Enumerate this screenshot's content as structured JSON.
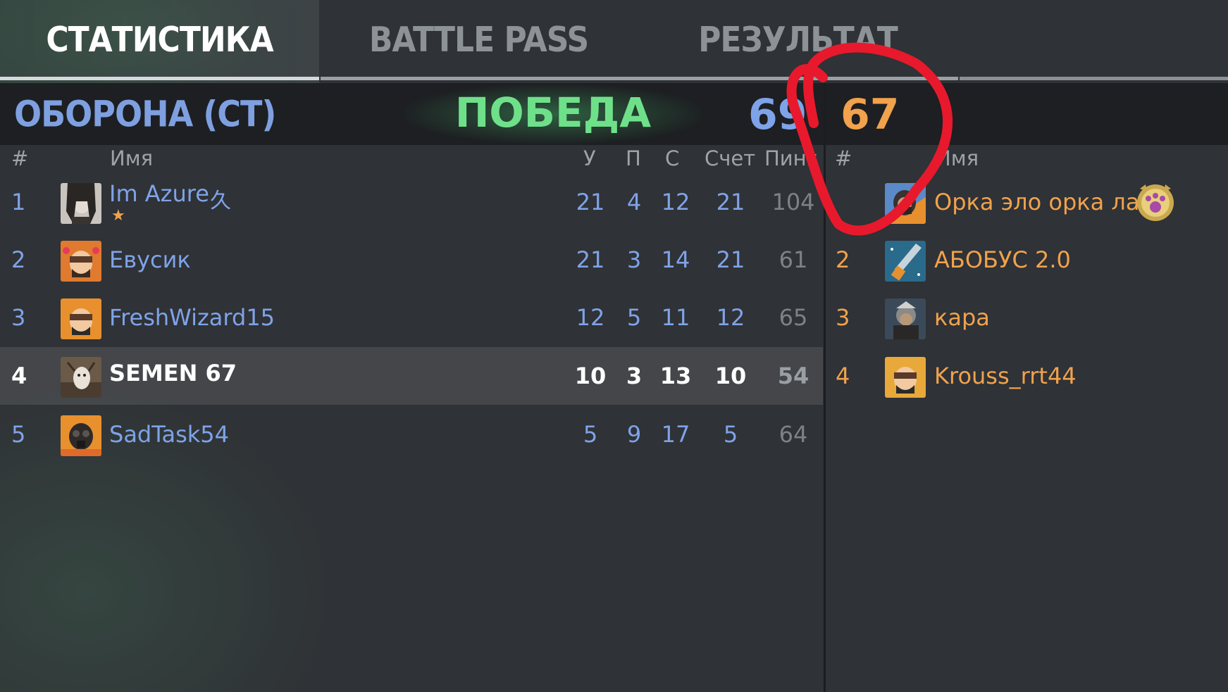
{
  "tabs": [
    {
      "label": "СТАТИСТИКА",
      "active": true
    },
    {
      "label": "BATTLE PASS",
      "active": false
    },
    {
      "label": "РЕЗУЛЬТАТ",
      "active": false
    }
  ],
  "header": {
    "team_name": "ОБОРОНА (СТ)",
    "result": "ПОБЕДА",
    "score_ct": "69",
    "score_t": "67"
  },
  "columns_ct": {
    "num": "#",
    "name": "Имя",
    "kills": "У",
    "deaths": "П",
    "assists": "С",
    "score": "Счет",
    "ping": "Пинг"
  },
  "columns_t": {
    "num": "#",
    "name": "Имя"
  },
  "players_ct": [
    {
      "num": "1",
      "name": "Im Azure",
      "rank_icon": "久",
      "kills": "21",
      "deaths": "4",
      "assists": "12",
      "score": "21",
      "ping": "104",
      "avatar": "girl-photo",
      "starred": true
    },
    {
      "num": "2",
      "name": "Евусик",
      "kills": "21",
      "deaths": "3",
      "assists": "14",
      "score": "21",
      "ping": "61",
      "avatar": "orange-hood-hearts"
    },
    {
      "num": "3",
      "name": "FreshWizard15",
      "kills": "12",
      "deaths": "5",
      "assists": "11",
      "score": "12",
      "ping": "65",
      "avatar": "orange-hood"
    },
    {
      "num": "4",
      "name": "SEMEN 67",
      "kills": "10",
      "deaths": "3",
      "assists": "13",
      "score": "10",
      "ping": "54",
      "avatar": "dog-photo",
      "self": true
    },
    {
      "num": "5",
      "name": "SadTask54",
      "kills": "5",
      "deaths": "9",
      "assists": "17",
      "score": "5",
      "ping": "64",
      "avatar": "gasmask"
    }
  ],
  "players_t": [
    {
      "num": "",
      "name": "Орка эло орка ла",
      "avatar": "hooded-orange",
      "badge": "paw-badge"
    },
    {
      "num": "2",
      "name": "АБОБУС 2.0",
      "avatar": "knife"
    },
    {
      "num": "3",
      "name": "кара",
      "avatar": "soldier-photo"
    },
    {
      "num": "4",
      "name": "Krouss_rrt44",
      "avatar": "orange-hood"
    }
  ],
  "colors": {
    "ct": "#7fa3e8",
    "t": "#f0a24d",
    "win": "#6fe08a",
    "annotation": "#e8192c"
  }
}
